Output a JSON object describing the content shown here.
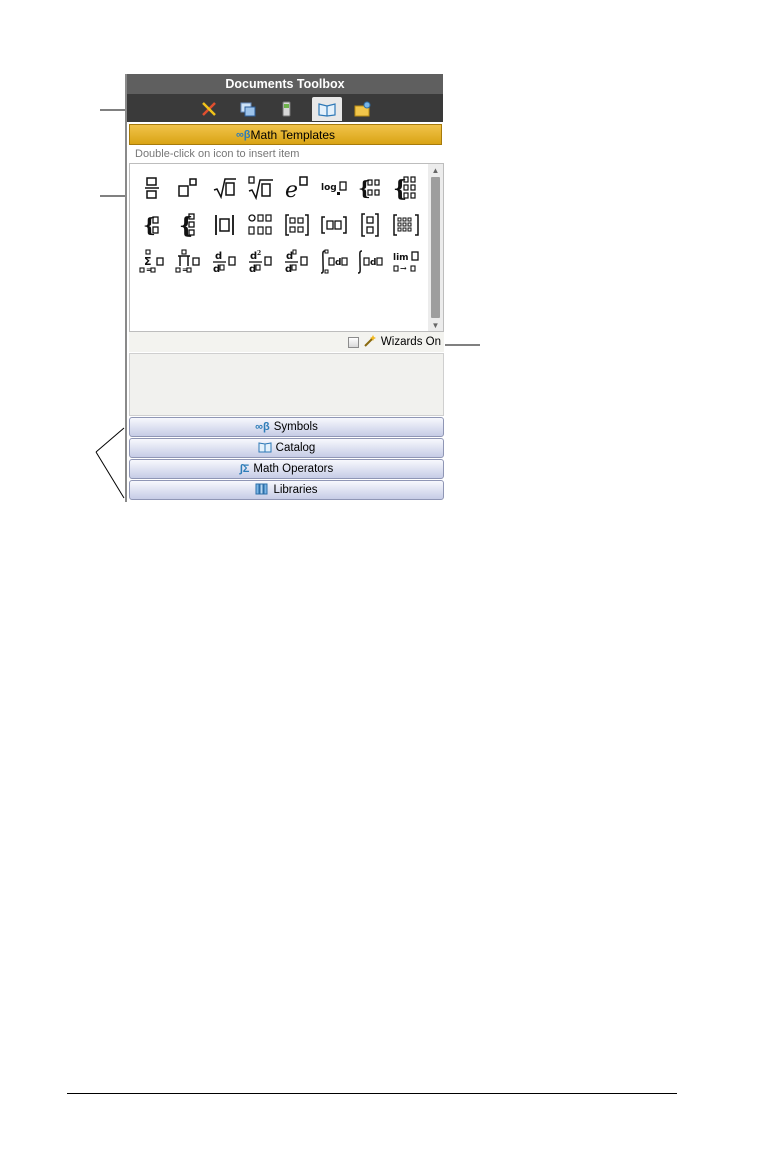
{
  "toolbox": {
    "title": "Documents Toolbox",
    "tabs": [
      {
        "icon": "tools-icon"
      },
      {
        "icon": "page-sorter-icon"
      },
      {
        "icon": "handheld-icon"
      },
      {
        "icon": "utilities-book-icon",
        "active": true
      },
      {
        "icon": "content-explorer-icon"
      }
    ],
    "active_category": "Math Templates",
    "hint": "Double-click on icon to insert item",
    "templates_row1": [
      "□/□",
      "□□",
      "√□",
      "□√□",
      "e□",
      "log□□",
      "{□:□",
      "{□□□"
    ],
    "templates_row2": [
      "{□",
      "{□□",
      "|□|",
      "□°'\"",
      "[□□]",
      "[□□]",
      "[□]",
      "[□□□]"
    ],
    "templates_row3": [
      "Σ□",
      "Π□",
      "d/d□",
      "d²/d□",
      "dⁿ/d□",
      "∫□d□",
      "∫□d□",
      "lim □"
    ],
    "wizards_label": "Wizards On",
    "categories": [
      {
        "label": "Symbols",
        "icon": "symbols-icon",
        "glyph": "∞β"
      },
      {
        "label": "Catalog",
        "icon": "catalog-icon",
        "glyph": "📖"
      },
      {
        "label": "Math Operators",
        "icon": "math-operators-icon",
        "glyph": "∫Σ"
      },
      {
        "label": "Libraries",
        "icon": "libraries-icon",
        "glyph": "▥"
      }
    ]
  },
  "colors": {
    "active_category_bg": "#e0a918",
    "title_bar": "#5f5f5f",
    "tab_bar": "#3a3a3a",
    "category_button": "#c6cce6"
  }
}
